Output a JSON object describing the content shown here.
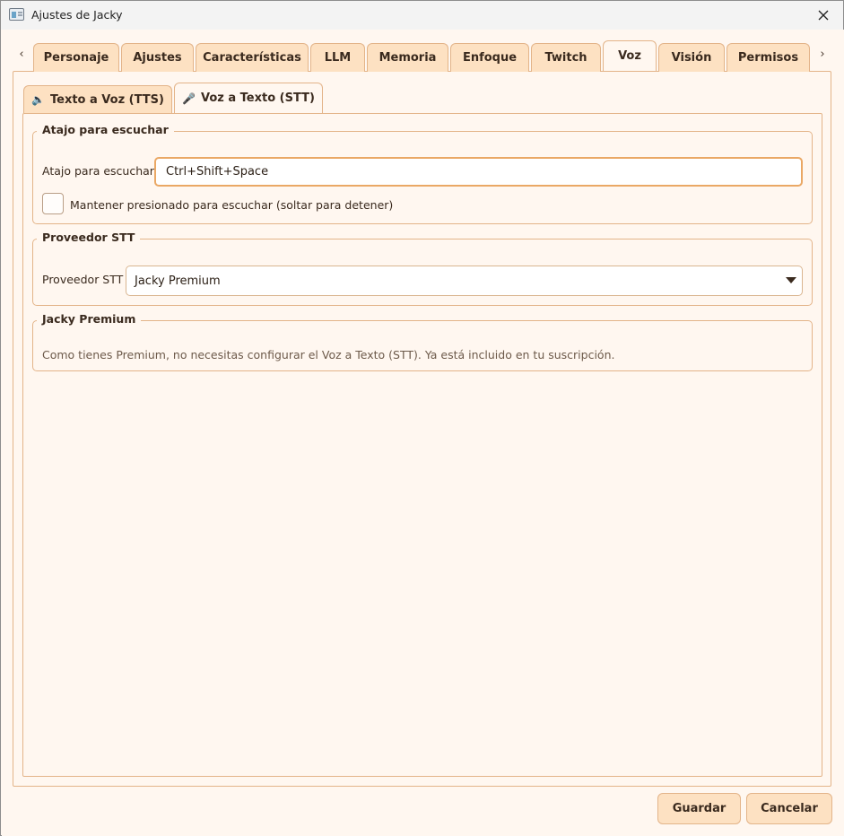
{
  "window": {
    "title": "Ajustes de Jacky"
  },
  "tabs": [
    {
      "label": "Personaje"
    },
    {
      "label": "Ajustes"
    },
    {
      "label": "Características"
    },
    {
      "label": "LLM"
    },
    {
      "label": "Memoria"
    },
    {
      "label": "Enfoque"
    },
    {
      "label": "Twitch"
    },
    {
      "label": "Voz",
      "active": true
    },
    {
      "label": "Visión"
    },
    {
      "label": "Permisos"
    }
  ],
  "subtabs": [
    {
      "label": "Texto a Voz (TTS)",
      "icon": "speaker-icon",
      "glyph": "🔈"
    },
    {
      "label": "Voz a Texto (STT)",
      "icon": "microphone-icon",
      "glyph": "🎤",
      "active": true
    }
  ],
  "hotkey_group": {
    "title": "Atajo para escuchar",
    "label": "Atajo para escuchar:",
    "value": "Ctrl+Shift+Space",
    "hold_checkbox_label": "Mantener presionado para escuchar (soltar para detener)",
    "hold_checked": false
  },
  "provider_group": {
    "title": "Proveedor STT",
    "label": "Proveedor STT",
    "selected": "Jacky Premium"
  },
  "premium_group": {
    "title": "Jacky Premium",
    "info": "Como tienes Premium, no necesitas configurar el Voz a Texto (STT). Ya está incluido en tu suscripción."
  },
  "buttons": {
    "save": "Guardar",
    "cancel": "Cancelar"
  },
  "colors": {
    "accent": "#eaa865",
    "tab_bg": "#fde1c2",
    "panel_bg": "#fff7f0",
    "border": "#e3b489"
  }
}
